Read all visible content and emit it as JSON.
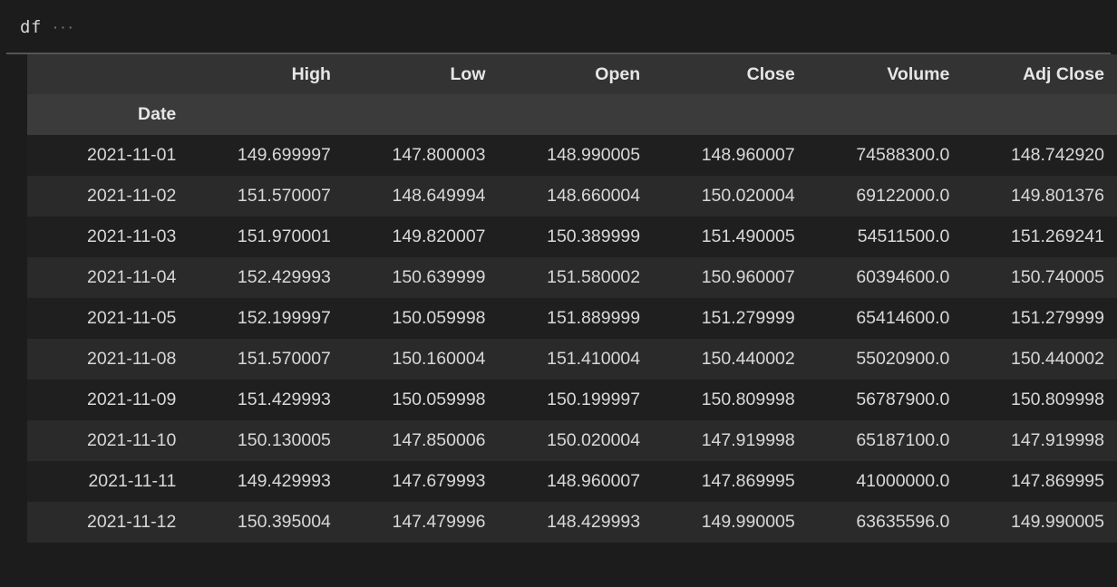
{
  "cell": {
    "variable_name": "df",
    "ellipsis": "···"
  },
  "table": {
    "index_name": "Date",
    "blank_corner": "",
    "columns": [
      "High",
      "Low",
      "Open",
      "Close",
      "Volume",
      "Adj Close"
    ],
    "rows": [
      {
        "index": "2021-11-01",
        "cells": [
          "149.699997",
          "147.800003",
          "148.990005",
          "148.960007",
          "74588300.0",
          "148.742920"
        ]
      },
      {
        "index": "2021-11-02",
        "cells": [
          "151.570007",
          "148.649994",
          "148.660004",
          "150.020004",
          "69122000.0",
          "149.801376"
        ]
      },
      {
        "index": "2021-11-03",
        "cells": [
          "151.970001",
          "149.820007",
          "150.389999",
          "151.490005",
          "54511500.0",
          "151.269241"
        ]
      },
      {
        "index": "2021-11-04",
        "cells": [
          "152.429993",
          "150.639999",
          "151.580002",
          "150.960007",
          "60394600.0",
          "150.740005"
        ]
      },
      {
        "index": "2021-11-05",
        "cells": [
          "152.199997",
          "150.059998",
          "151.889999",
          "151.279999",
          "65414600.0",
          "151.279999"
        ]
      },
      {
        "index": "2021-11-08",
        "cells": [
          "151.570007",
          "150.160004",
          "151.410004",
          "150.440002",
          "55020900.0",
          "150.440002"
        ]
      },
      {
        "index": "2021-11-09",
        "cells": [
          "151.429993",
          "150.059998",
          "150.199997",
          "150.809998",
          "56787900.0",
          "150.809998"
        ]
      },
      {
        "index": "2021-11-10",
        "cells": [
          "150.130005",
          "147.850006",
          "150.020004",
          "147.919998",
          "65187100.0",
          "147.919998"
        ]
      },
      {
        "index": "2021-11-11",
        "cells": [
          "149.429993",
          "147.679993",
          "148.960007",
          "147.869995",
          "41000000.0",
          "147.869995"
        ]
      },
      {
        "index": "2021-11-12",
        "cells": [
          "150.395004",
          "147.479996",
          "148.429993",
          "149.990005",
          "63635596.0",
          "149.990005"
        ]
      }
    ]
  },
  "colors": {
    "page_background": "#1c1c1c",
    "row_background": "#1f1f1f",
    "row_alt_background": "#2a2a2a",
    "column_header_background": "#333333",
    "index_header_background": "#3b3b3b",
    "text": "#d8d8d8",
    "header_text": "#e6e6e6",
    "rule": "#555555",
    "muted_text": "#7a7a7a"
  }
}
